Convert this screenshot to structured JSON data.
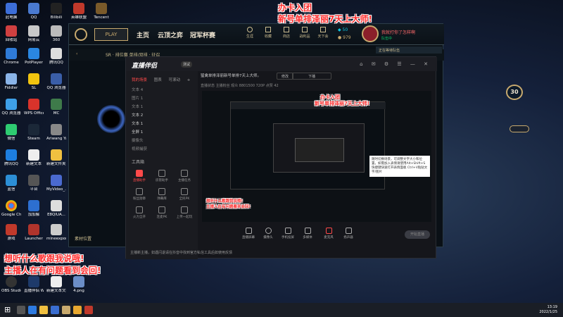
{
  "desktop": {
    "icons": [
      {
        "label": "此电脑"
      },
      {
        "label": "回收站"
      },
      {
        "label": "网易云"
      },
      {
        "label": "360"
      },
      {
        "label": "Chrome"
      },
      {
        "label": "PotPlayer"
      },
      {
        "label": "腾讯QQ"
      },
      {
        "label": "Fiddler"
      },
      {
        "label": "SL"
      },
      {
        "label": "QQ 浏览器"
      },
      {
        "label": "WPS Office"
      },
      {
        "label": "MC"
      },
      {
        "label": "微信"
      },
      {
        "label": "Steam"
      },
      {
        "label": "Ariwang YaPig"
      },
      {
        "label": "腾讯QQ"
      },
      {
        "label": "新建文本"
      },
      {
        "label": "新建文件夹 (2)"
      },
      {
        "label": "蓝信"
      },
      {
        "label": "平台"
      },
      {
        "label": "MyVideo_..."
      },
      {
        "label": "Google Chrome"
      },
      {
        "label": "加加解"
      },
      {
        "label": "E8QIUA..."
      },
      {
        "label": "游戏"
      },
      {
        "label": "Launcher"
      },
      {
        "label": "mineexport..."
      },
      {
        "label": "OBS Studio"
      },
      {
        "label": "直播伴侣 WeGame"
      },
      {
        "label": "新建文本文档 (2)"
      },
      {
        "label": "4.png"
      }
    ],
    "top_icons": [
      {
        "label": "QQ"
      },
      {
        "label": "Bilibili"
      },
      {
        "label": "英雄联盟"
      },
      {
        "label": "Tencent"
      }
    ],
    "folder_label": "素材(我的)"
  },
  "overlays": {
    "top_line1": "办卡入团",
    "top_line2": "新号单排泽丽7天上大师!",
    "bottom_line1": "想听什么歌跟我说哦!",
    "bottom_line2": "主播人在有问题看到会回!"
  },
  "lol": {
    "play_label": "PLAY",
    "nav": [
      "主页",
      "云顶之弈",
      "冠军杯赛"
    ],
    "right_icons": [
      "生涯",
      "收藏",
      "商店",
      "战利品",
      "天下会"
    ],
    "currency_be": "50",
    "currency_rp": "979",
    "username": "我就打你了怎样啊",
    "status": "队伍中",
    "mode_line": "SR · 排位赛 单排/双排 · 征召",
    "footer_label": "素材位置",
    "right_panel_label": "正在等待队伍",
    "level_badge": "30"
  },
  "app": {
    "brand": "直播伴侣",
    "version": "测试",
    "side_tabs": [
      "我的场景",
      "图表",
      "可滚动"
    ],
    "sources": [
      "文本 4",
      "图片 1",
      "文本 1",
      "文本 2",
      "文本 1",
      "全屏 1",
      "摄像头",
      "视频捕获"
    ],
    "tools_title": "工具箱",
    "tools": [
      "直播助手",
      "房管助手",
      "主播任务",
      "粉丝勋章",
      "弹幕库",
      "全民PK",
      "火力全开",
      "连麦PK",
      "上传一起玩"
    ],
    "title_text": "猛禽单排泽丽新号单排7天上大师。",
    "btn_modify": "修改",
    "btn_download": "下播",
    "metrics": "直播状态  主播粉丝  观众 8801500  720P  点赞 42",
    "tooltip": "随时切换场景，可调整文字大小和位置，如需加入表情请使用Alt+Shift+S快捷键快速打开表情面板 Ctrl+V粘贴文字/图片",
    "bottom_tools": [
      "直播屏幕",
      "摄像头",
      "手机投屏",
      "多媒体",
      "麦克风",
      "扬声器"
    ],
    "start_label": "开始直播",
    "notice": "主播新主播，如遇闪退请在抖音中找到官方私信工具后如使用反馈"
  },
  "preview": {
    "overlay_line1": "办卡入团",
    "overlay_line2": "新号单排泽丽7天上大师!",
    "bottom_line1": "想听什么歌跟我说哦!",
    "bottom_line2": "主播人在有问题看到会回!"
  },
  "taskbar": {
    "time": "13:19",
    "date": "2022/1/25"
  },
  "colors": {
    "overlay_red": "#ff2d2d",
    "accent_gold": "#c8aa6e",
    "app_accent": "#ff4a4a"
  }
}
